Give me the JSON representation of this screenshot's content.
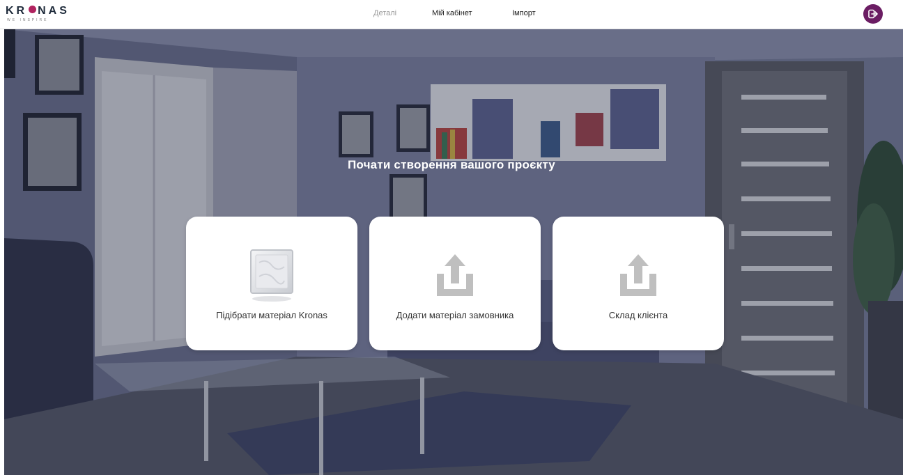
{
  "brand": {
    "name_pre": "KR",
    "name_post": "NAS",
    "tagline": "WE INSPIRE",
    "accent": "#6b1d63",
    "logo_dot": "#b0235f"
  },
  "nav": {
    "items": [
      {
        "label": "Деталі",
        "state": "muted"
      },
      {
        "label": "Мій кабінет",
        "state": "normal"
      },
      {
        "label": "Імпорт",
        "state": "normal"
      }
    ],
    "logout_icon": "logout-icon"
  },
  "main": {
    "title": "Почати створення вашого проєкту",
    "cards": [
      {
        "label": "Підібрати матеріал Kronas",
        "icon": "glass-block-icon"
      },
      {
        "label": "Додати матеріал замовника",
        "icon": "upload-icon"
      },
      {
        "label": "Склад клієнта",
        "icon": "upload-icon"
      }
    ]
  }
}
